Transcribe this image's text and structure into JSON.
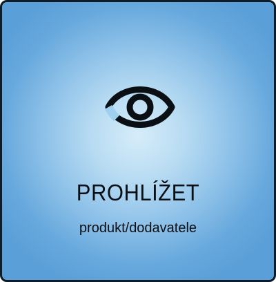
{
  "tile": {
    "icon": "eye-icon",
    "title": "PROHLÍŽET",
    "subtitle": "produkt/dodavatele",
    "colors": {
      "background_center": "#d6edf9",
      "background_edge": "#5a9fd8",
      "border": "#0f1b26",
      "text": "#0a0f14"
    }
  }
}
